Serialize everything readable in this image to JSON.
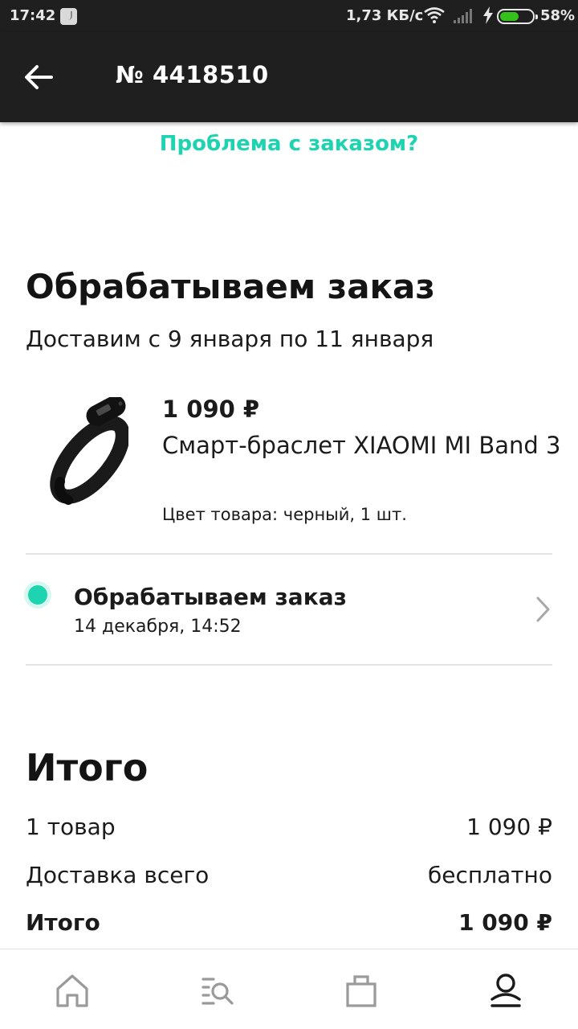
{
  "status_bar": {
    "time": "17:42",
    "network_speed": "1,73 КБ/с",
    "battery": "58%",
    "battery_level": 0.58,
    "icons": [
      "tiktok-icon",
      "wifi-icon",
      "signal-icon",
      "charging-icon",
      "battery-icon"
    ]
  },
  "header": {
    "title": "№ 4418510",
    "back_icon": "arrow-left-icon"
  },
  "problem_link": "Проблема с заказом?",
  "order": {
    "status_title": "Обрабатываем заказ",
    "delivery": "Доставим с 9 января по 11 января",
    "product": {
      "price": "1 090 ₽",
      "name": "Смарт-браслет XIAOMI MI Band 3",
      "options": "Цвет товара: черный, 1 шт.",
      "image_icon": "fitness-band-image"
    },
    "tracking": {
      "status": "Обрабатываем заказ",
      "date": "14 декабря, 14:52",
      "chevron_icon": "chevron-right-icon"
    }
  },
  "summary": {
    "heading": "Итого",
    "rows": [
      {
        "label": "1 товар",
        "value": "1 090 ₽"
      },
      {
        "label": "Доставка всего",
        "value": "бесплатно"
      },
      {
        "label": "Итого",
        "value": "1 090 ₽"
      }
    ]
  },
  "bottom_nav": {
    "items": [
      "home-icon",
      "catalog-search-icon",
      "shopping-bag-icon",
      "profile-icon"
    ],
    "active": "profile-icon"
  },
  "colors": {
    "accent": "#1ED3B0",
    "app_bar": "#1F1F1F",
    "text": "#1B1B1B",
    "divider": "#E3E3E3",
    "battery_fill": "#35C11C"
  }
}
